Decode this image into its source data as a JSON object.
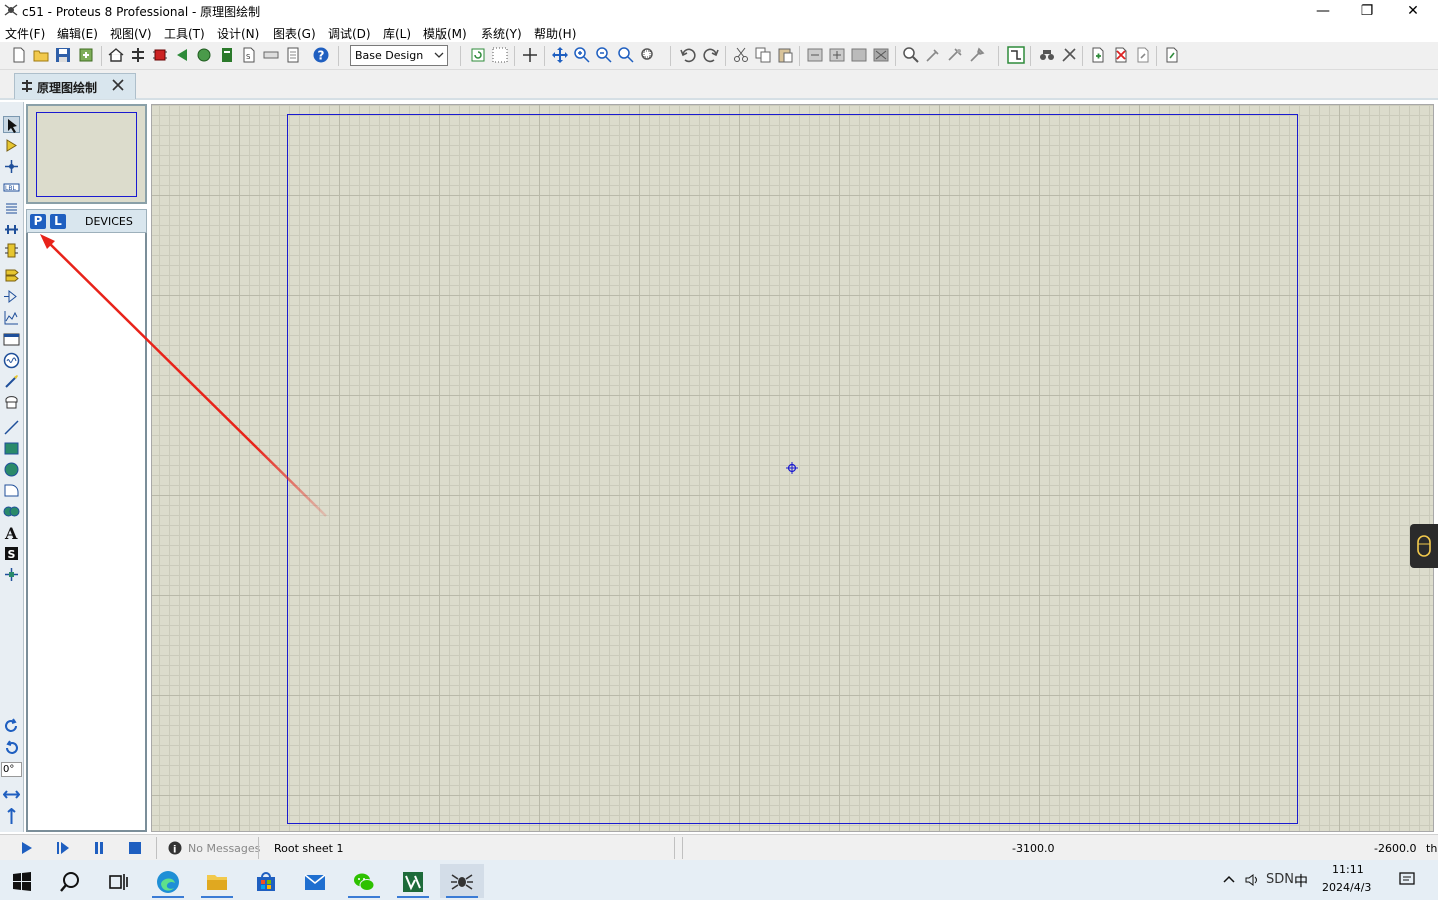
{
  "window": {
    "title": "c51 - Proteus 8 Professional - 原理图绘制",
    "minimize_glyph": "—",
    "maximize_glyph": "❐",
    "close_glyph": "✕"
  },
  "menu": [
    "文件(F)",
    "编辑(E)",
    "视图(V)",
    "工具(T)",
    "设计(N)",
    "图表(G)",
    "调试(D)",
    "库(L)",
    "模版(M)",
    "系统(Y)",
    "帮助(H)"
  ],
  "toolbar": {
    "design_select": "Base Design",
    "icons": [
      "new-file-icon",
      "open-folder-icon",
      "save-icon",
      "import-icon",
      "home-icon",
      "schematic-icon",
      "pcb-icon",
      "back-icon",
      "gerber-icon",
      "bom-icon",
      "source-icon",
      "report-icon",
      "notes-icon",
      "help-icon",
      "refresh-icon",
      "grid-icon",
      "origin-icon",
      "pan-icon",
      "zoom-in-icon",
      "zoom-out-icon",
      "zoom-all-icon",
      "zoom-area-icon",
      "undo-icon",
      "redo-icon",
      "cut-icon",
      "copy-icon",
      "paste-icon",
      "block-copy-icon",
      "block-move-icon",
      "block-rotate-icon",
      "block-delete-icon",
      "pick-device-icon",
      "make-device-icon",
      "packaging-icon",
      "decompose-icon",
      "wire-autorouter-icon",
      "search-tag-icon",
      "property-tool-icon",
      "new-sheet-icon",
      "remove-sheet-icon",
      "exit-parent-icon",
      "netlist-icon"
    ]
  },
  "tabs": [
    {
      "label": "原理图绘制",
      "close_glyph": "✕"
    }
  ],
  "palette": {
    "tools": [
      "selection-mode-icon",
      "component-mode-icon",
      "junction-dot-icon",
      "wire-label-icon",
      "text-script-icon",
      "buses-icon",
      "subcircuit-icon",
      "terminals-icon",
      "device-pins-icon",
      "graph-icon",
      "tape-recorder-icon",
      "generator-icon",
      "voltage-probe-icon",
      "virtual-instruments-icon",
      "line-icon",
      "box-icon",
      "circle-icon",
      "arc-icon",
      "closed-path-icon",
      "text-icon",
      "symbol-icon",
      "marker-icon"
    ],
    "orientation": [
      "rotate-clockwise-icon",
      "rotate-anticlockwise-icon"
    ],
    "rotation_angle": "0°",
    "mirror": [
      "mirror-x-icon",
      "mirror-y-icon"
    ]
  },
  "devices_panel": {
    "pick_button": "P",
    "library_button": "L",
    "title": "DEVICES",
    "items": []
  },
  "status": {
    "messages": "No Messages",
    "sheet": "Root sheet 1",
    "x": "-3100.0",
    "y": "-2600.0",
    "unit": "th"
  },
  "taskbar": {
    "apps": [
      "start-icon",
      "search-icon",
      "task-view-icon",
      "edge-icon",
      "file-explorer-icon",
      "store-icon",
      "mail-icon",
      "wechat-icon",
      "vivado-icon",
      "proteus-icon"
    ],
    "tray_text": "SDN",
    "ime": "中",
    "time": "11:11",
    "date": "2024/4/3"
  },
  "colors": {
    "canvas": "#dcdccc",
    "sheet_border": "#1a1ad0",
    "annotation_arrow": "#e8231a",
    "panel_header": "#d9e6ee"
  }
}
